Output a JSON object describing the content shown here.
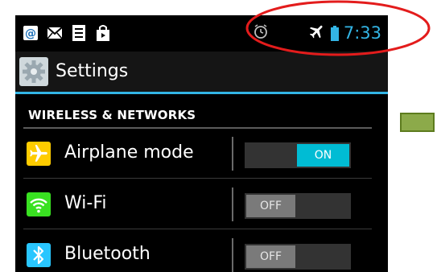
{
  "status_bar": {
    "icons_left": [
      "email-at-icon",
      "gmail-icon",
      "sim-card-icon",
      "store-bag-icon"
    ],
    "icons_right": [
      "alarm-icon",
      "airplane-icon",
      "battery-icon"
    ],
    "time": "7:33"
  },
  "action_bar": {
    "icon": "settings-gear-icon",
    "title": "Settings"
  },
  "section": {
    "title": "WIRELESS & NETWORKS"
  },
  "rows": [
    {
      "label": "Airplane mode",
      "icon": "airplane-icon",
      "icon_bg": "#ffcc00",
      "toggle": "ON",
      "checked": true
    },
    {
      "label": "Wi-Fi",
      "icon": "wifi-icon",
      "icon_bg": "#39e121",
      "toggle": "OFF",
      "checked": false
    },
    {
      "label": "Bluetooth",
      "icon": "bluetooth-icon",
      "icon_bg": "#29c6ff",
      "toggle": "OFF",
      "checked": false
    }
  ],
  "colors": {
    "accent": "#33b5e5",
    "toggle_on": "#00bcd4",
    "annotation_red": "#e31c1c",
    "annotation_green": "#8caa4a"
  }
}
